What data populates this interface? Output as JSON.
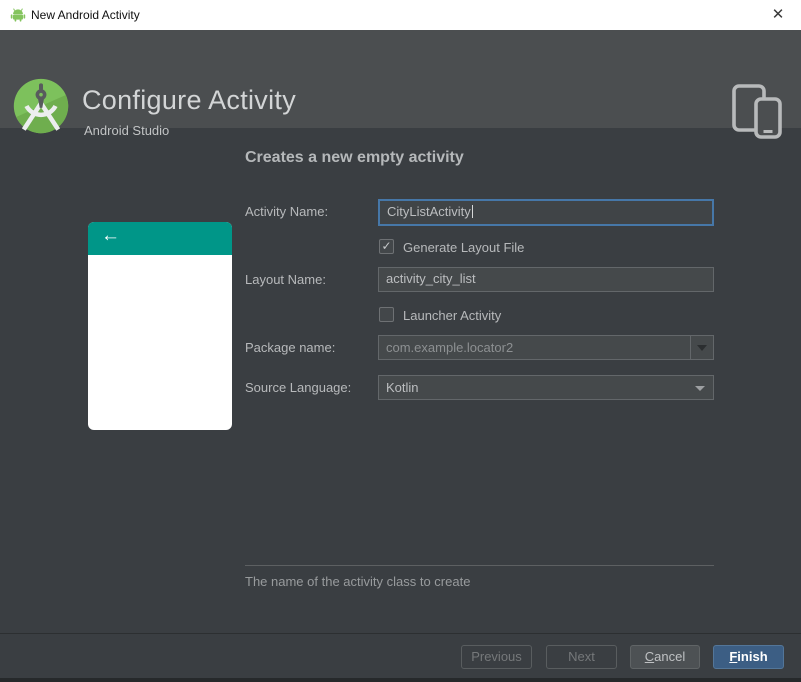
{
  "titlebar": {
    "title": "New Android Activity"
  },
  "header": {
    "title": "Configure Activity",
    "subtitle": "Android Studio"
  },
  "main": {
    "heading": "Creates a new empty activity",
    "form": {
      "activity_name": {
        "label": "Activity Name:",
        "value": "CityListActivity"
      },
      "generate_layout_file": {
        "label": "Generate Layout File",
        "checked": true
      },
      "layout_name": {
        "label": "Layout Name:",
        "value": "activity_city_list"
      },
      "launcher_activity": {
        "label": "Launcher Activity",
        "checked": false
      },
      "package_name": {
        "label": "Package name:",
        "value": "com.example.locator2"
      },
      "source_language": {
        "label": "Source Language:",
        "value": "Kotlin"
      }
    },
    "hint": "The name of the activity class to create"
  },
  "footer": {
    "previous": {
      "label": "Previous",
      "enabled": false
    },
    "next": {
      "label": "Next",
      "enabled": false
    },
    "cancel": {
      "head": "C",
      "tail": "ancel",
      "enabled": true
    },
    "finish": {
      "head": "F",
      "tail": "inish",
      "enabled": true,
      "primary": true
    }
  },
  "icons": {
    "checkmark": "✓",
    "close": "✕",
    "back_arrow": "←"
  },
  "colors": {
    "teal_accent": "#009688",
    "focus_border": "#4677a8",
    "primary_button": "#3c5e84",
    "header_bg": "#4b4e50",
    "content_bg": "#3a3e42",
    "titlebar_bg": "#ffffff"
  }
}
